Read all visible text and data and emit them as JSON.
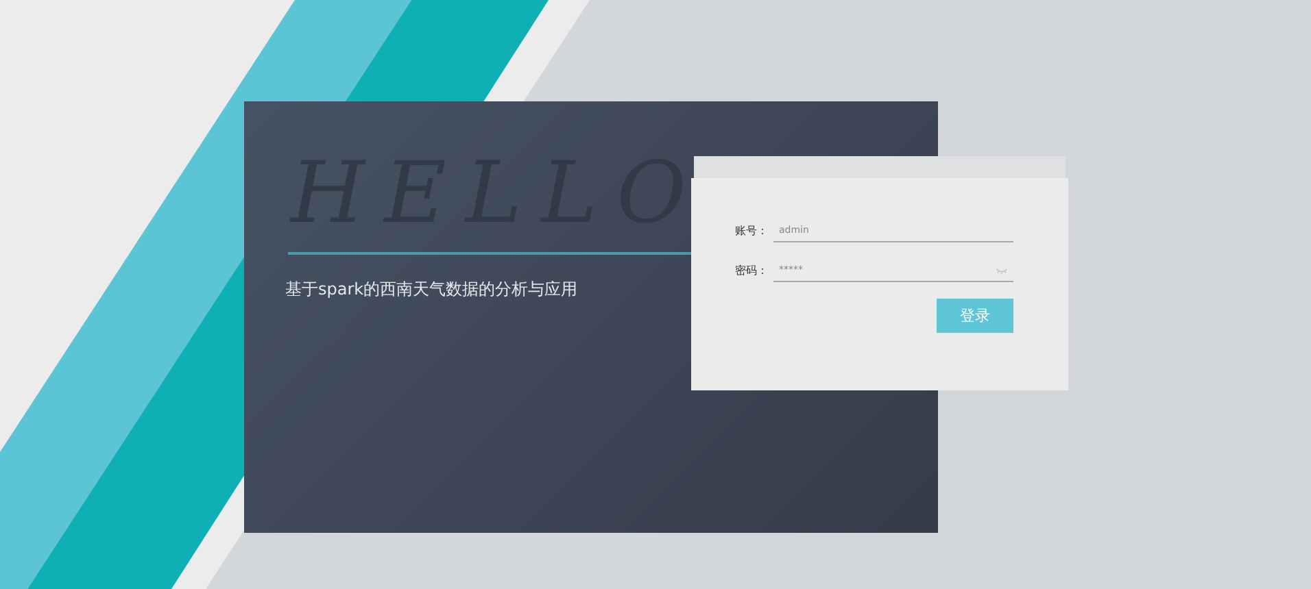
{
  "hero": {
    "watermark": "HELLO",
    "subtitle": "基于spark的西南天气数据的分析与应用"
  },
  "login_form": {
    "fields": [
      {
        "label": "账号：",
        "value": "admin",
        "kind": "text"
      },
      {
        "label": "密码：",
        "value": "*****",
        "kind": "password"
      }
    ],
    "submit": "登录"
  }
}
